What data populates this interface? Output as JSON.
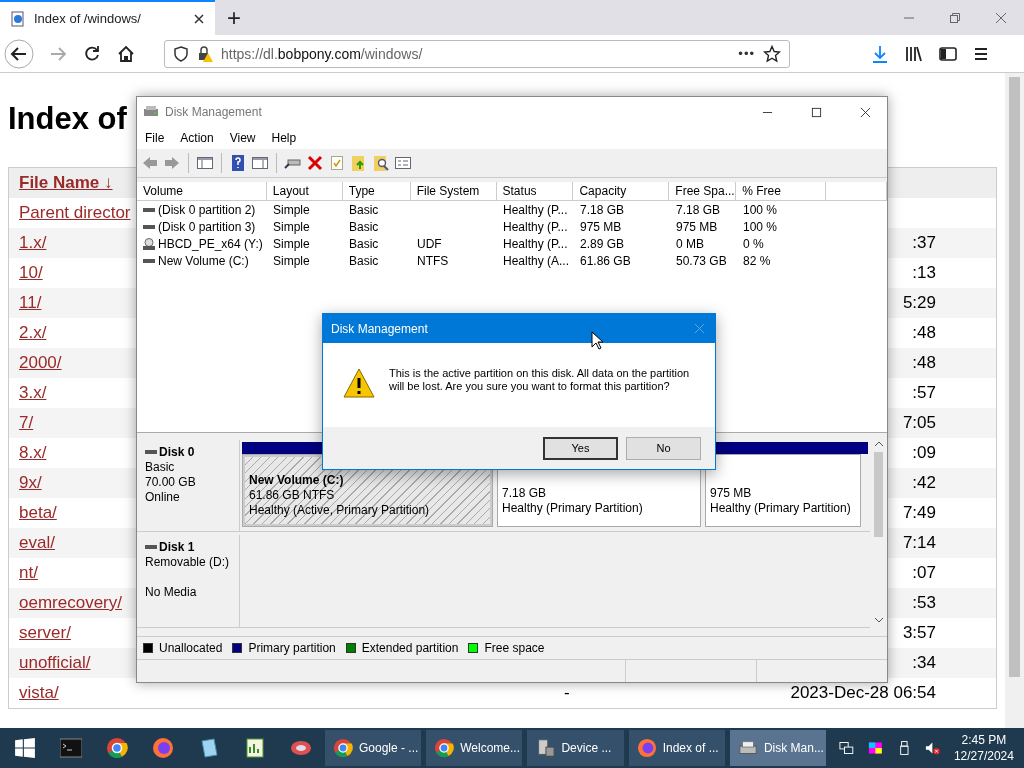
{
  "browser": {
    "tabs": [
      {
        "title": "Index of /windows/",
        "selected": true
      }
    ],
    "new_tab": "+",
    "url": {
      "start": "https://dl.",
      "domain": "bobpony.com",
      "path": "/windows/"
    },
    "more": "•••"
  },
  "page": {
    "heading": "Index of",
    "header": "File Name ↓",
    "rows": [
      {
        "name": "Parent director",
        "size": "",
        "date": ""
      },
      {
        "name": "1.x/",
        "size": "",
        "date": ":37"
      },
      {
        "name": "10/",
        "size": "",
        "date": ":13"
      },
      {
        "name": "11/",
        "size": "",
        "date": "5:29"
      },
      {
        "name": "2.x/",
        "size": "",
        "date": ":48"
      },
      {
        "name": "2000/",
        "size": "",
        "date": ":48"
      },
      {
        "name": "3.x/",
        "size": "",
        "date": ":57"
      },
      {
        "name": "7/",
        "size": "",
        "date": "7:05"
      },
      {
        "name": "8.x/",
        "size": "",
        "date": ":09"
      },
      {
        "name": "9x/",
        "size": "",
        "date": ":42"
      },
      {
        "name": "beta/",
        "size": "",
        "date": "7:49"
      },
      {
        "name": "eval/",
        "size": "",
        "date": "7:14"
      },
      {
        "name": "nt/",
        "size": "",
        "date": ":07"
      },
      {
        "name": "oemrecovery/",
        "size": "",
        "date": ":53"
      },
      {
        "name": "server/",
        "size": "",
        "date": "3:57"
      },
      {
        "name": "unofficial/",
        "size": "",
        "date": ":34"
      },
      {
        "name": "vista/",
        "size": "-",
        "date": "2023-Dec-28 06:54"
      }
    ]
  },
  "disk_management": {
    "title": "Disk Management",
    "menu": [
      "File",
      "Action",
      "View",
      "Help"
    ],
    "columns": [
      "Volume",
      "Layout",
      "Type",
      "File System",
      "Status",
      "Capacity",
      "Free Spa...",
      "% Free"
    ],
    "volumes": [
      {
        "kind": "drive",
        "cells": [
          "(Disk 0 partition 2)",
          "Simple",
          "Basic",
          "",
          "Healthy (P...",
          "7.18 GB",
          "7.18 GB",
          "100 %"
        ]
      },
      {
        "kind": "drive",
        "cells": [
          "(Disk 0 partition 3)",
          "Simple",
          "Basic",
          "",
          "Healthy (P...",
          "975 MB",
          "975 MB",
          "100 %"
        ]
      },
      {
        "kind": "disc",
        "cells": [
          "HBCD_PE_x64 (Y:)",
          "Simple",
          "Basic",
          "UDF",
          "Healthy (P...",
          "2.89 GB",
          "0 MB",
          "0 %"
        ]
      },
      {
        "kind": "drive",
        "cells": [
          "New Volume (C:)",
          "Simple",
          "Basic",
          "NTFS",
          "Healthy (A...",
          "61.86 GB",
          "50.73 GB",
          "82 %"
        ]
      }
    ],
    "disks": [
      {
        "name": "Disk 0",
        "type": "Basic",
        "size": "70.00 GB",
        "status": "Online",
        "partitions": [
          {
            "name": "New Volume (C:)",
            "size": "61.86 GB NTFS",
            "status": "Healthy (Active, Primary Partition)",
            "selected": true
          },
          {
            "size": "7.18 GB",
            "status": "Healthy (Primary Partition)",
            "selected": false
          },
          {
            "size": "975 MB",
            "status": "Healthy (Primary Partition)",
            "selected": false
          }
        ]
      },
      {
        "name": "Disk 1",
        "type": "Removable (D:)",
        "status": "No Media"
      }
    ],
    "legend": [
      {
        "label": "Unallocated",
        "color": "#000000"
      },
      {
        "label": "Primary partition",
        "color": "#000080"
      },
      {
        "label": "Extended partition",
        "color": "#008000"
      },
      {
        "label": "Free space",
        "color": "#00ff00"
      }
    ]
  },
  "dialog": {
    "title": "Disk Management",
    "message": "This is the active partition on this disk. All data on the partition will be lost. Are you sure you want to format this partition?",
    "buttons": [
      {
        "label": "Yes",
        "selected": true
      },
      {
        "label": "No",
        "selected": false
      }
    ]
  },
  "taskbar": {
    "tasks": [
      {
        "kind": "chrome",
        "label": "Google - ...",
        "selected": false
      },
      {
        "kind": "chrome",
        "label": "Welcome...",
        "selected": false
      },
      {
        "kind": "device",
        "label": "Device ...",
        "selected": false
      },
      {
        "kind": "firefox",
        "label": "Index of ...",
        "selected": false
      },
      {
        "kind": "disk",
        "label": "Disk Man...",
        "selected": true
      }
    ],
    "time": "2:45 PM",
    "date": "12/27/2024"
  }
}
